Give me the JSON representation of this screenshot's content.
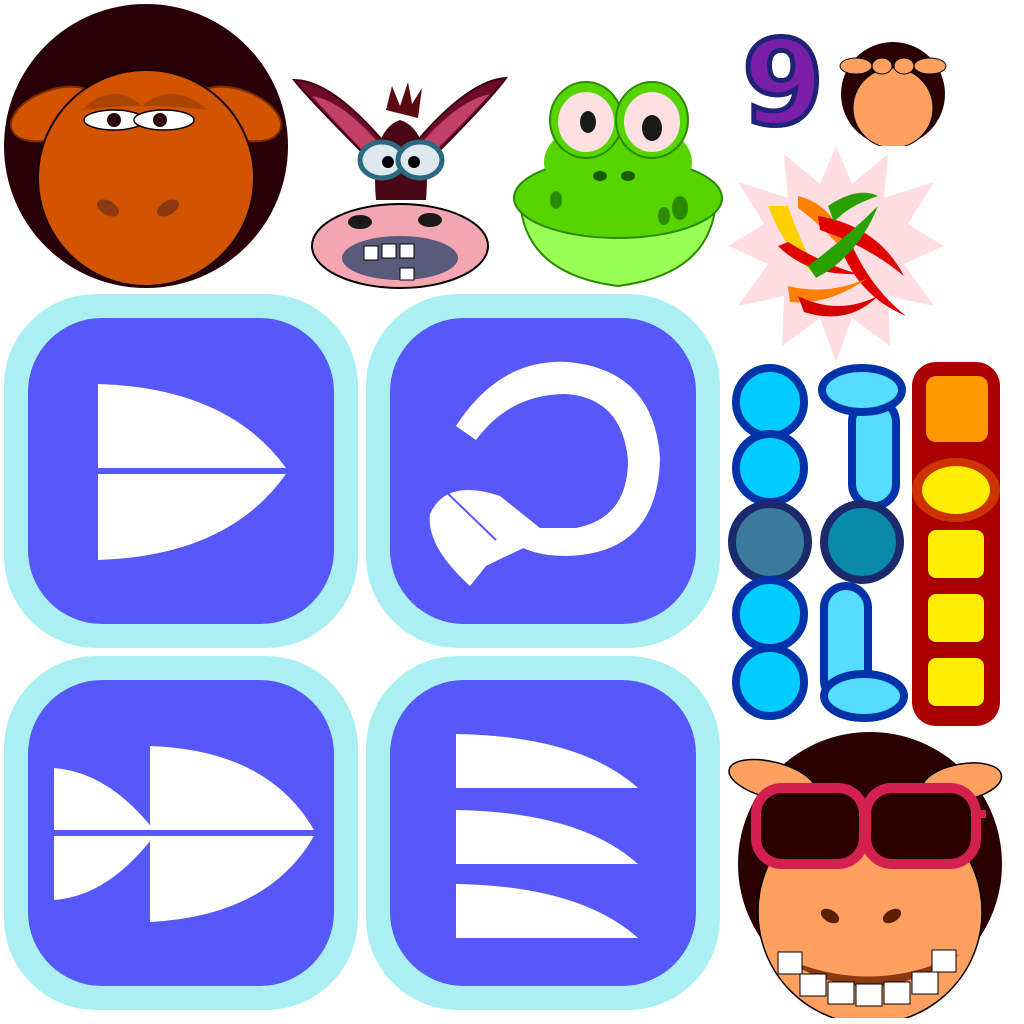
{
  "canvas": {
    "background": "#ffffff"
  },
  "sprites": {
    "bull_face": {
      "icon": "bull-face-icon",
      "colors": {
        "fur": "#2a0008",
        "face": "#d35400"
      }
    },
    "donkey_face": {
      "icon": "donkey-face-icon",
      "colors": {
        "ears": "#6e0a2a",
        "muzzle": "#f4a6b0"
      }
    },
    "frog_face": {
      "icon": "frog-face-icon",
      "colors": {
        "skin": "#55d400",
        "belly": "#99ff55"
      }
    },
    "number_nine": {
      "label": "9",
      "colors": {
        "fill": "#7a1fa8",
        "stroke": "#20227a"
      }
    },
    "monkey_small": {
      "icon": "monkey-head-icon",
      "colors": {
        "fur": "#2a0000",
        "face": "#ffa060"
      }
    },
    "chili_burst": {
      "icon": "chili-pepper-burst-icon",
      "colors": {
        "burst": "#ffdde0",
        "pepper": "#e00000"
      }
    },
    "bead_columns": {
      "icon": "abacus-beads-icon",
      "colors": {
        "blue": "#00ccff",
        "outline": "#0033aa",
        "orange": "#ff9900",
        "yellow": "#ffee00",
        "red_border": "#aa0000"
      }
    },
    "monkey_sunglasses": {
      "icon": "cool-monkey-face-icon",
      "colors": {
        "fur": "#2a0000",
        "face": "#ffa060",
        "glasses": "#d4204f"
      }
    }
  },
  "tiles": [
    {
      "icon": "split-d-shape-icon",
      "colors": {
        "outer": "#aaf0f2",
        "inner": "#5658fa",
        "glyph": "#ffffff"
      }
    },
    {
      "icon": "rotate-arrow-icon",
      "colors": {
        "outer": "#aaf0f2",
        "inner": "#5658fa",
        "glyph": "#ffffff"
      }
    },
    {
      "icon": "double-arrow-forward-icon",
      "colors": {
        "outer": "#aaf0f2",
        "inner": "#5658fa",
        "glyph": "#ffffff"
      }
    },
    {
      "icon": "three-wings-list-icon",
      "colors": {
        "outer": "#aaf0f2",
        "inner": "#5658fa",
        "glyph": "#ffffff"
      }
    }
  ]
}
